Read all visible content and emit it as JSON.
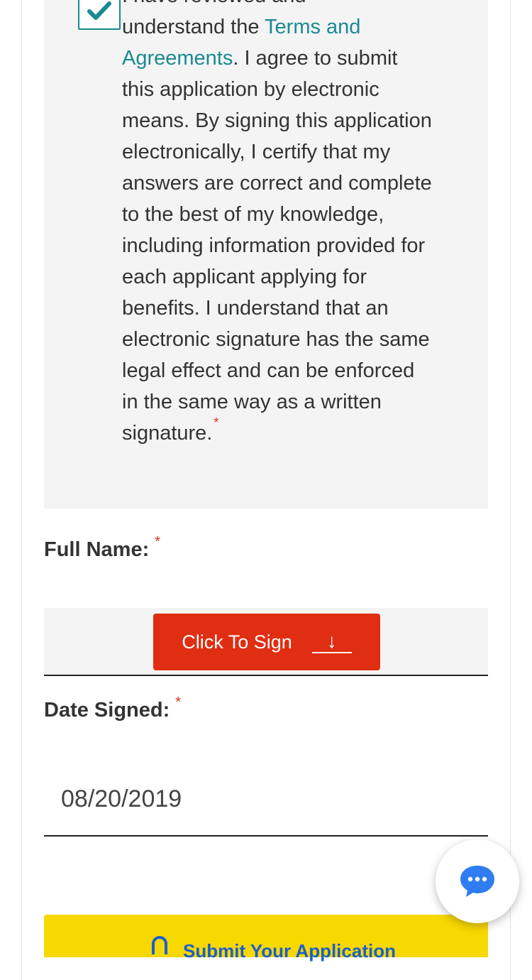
{
  "consent": {
    "line_0": "I have reviewed and",
    "line_1_prefix": "understand the ",
    "terms_link": "Terms and Agreements",
    "body": ". I agree to submit this application by electronic means. By signing this application electronically, I certify that my answers are correct and complete to the best of my knowledge, including information provided for each applicant applying for benefits. I understand that an electronic signature has the same legal effect and can be enforced in the same way as a written signature.",
    "required_mark": "*",
    "checked": true
  },
  "full_name": {
    "label": "Full Name:",
    "required_mark": "*"
  },
  "sign_button": {
    "label": "Click To Sign",
    "arrow": "↓"
  },
  "date_signed": {
    "label": "Date Signed:",
    "required_mark": "*",
    "value": "08/20/2019"
  },
  "submit": {
    "label": "Submit Your Application"
  },
  "colors": {
    "accent": "#1a8a91",
    "danger": "#e02e12",
    "submit_bg": "#f7d800",
    "chat_blue": "#2f7df0"
  },
  "icons": {
    "checkbox": "checkmark-icon",
    "chat": "chat-bubble-icon",
    "lock": "lock-icon"
  }
}
